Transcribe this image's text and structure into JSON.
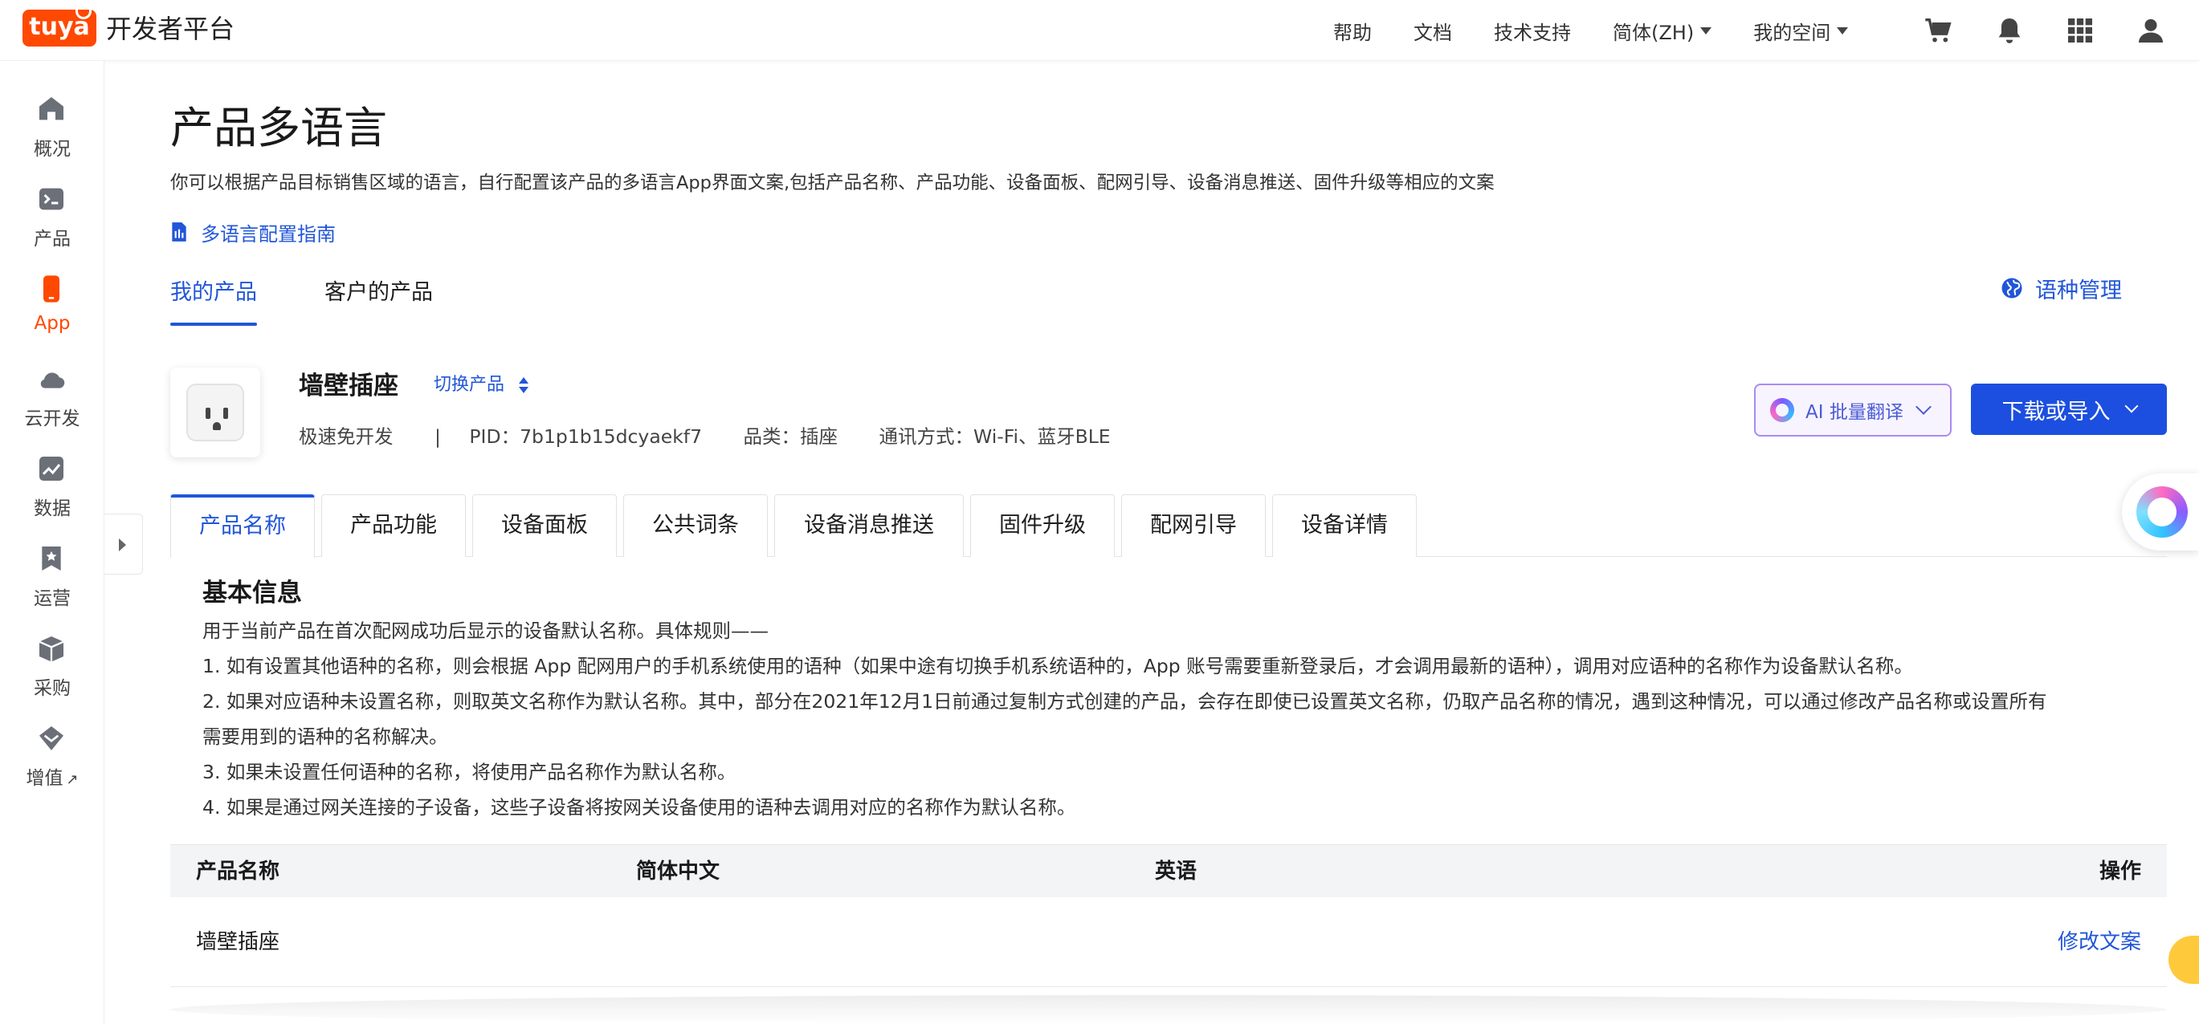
{
  "header": {
    "logo_text": "tuya",
    "brand": "开发者平台",
    "nav": [
      {
        "label": "帮助",
        "has_caret": false
      },
      {
        "label": "文档",
        "has_caret": false
      },
      {
        "label": "技术支持",
        "has_caret": false
      },
      {
        "label": "简体(ZH)",
        "has_caret": true
      },
      {
        "label": "我的空间",
        "has_caret": true
      }
    ],
    "icons": [
      "cart-icon",
      "bell-icon",
      "grid-apps-icon",
      "user-icon"
    ]
  },
  "sidebar": {
    "items": [
      {
        "label": "概况",
        "icon": "home-icon",
        "active": false
      },
      {
        "label": "产品",
        "icon": "terminal-icon",
        "active": false
      },
      {
        "label": "App",
        "icon": "phone-icon",
        "active": true
      },
      {
        "label": "云开发",
        "icon": "cloud-icon",
        "active": false
      },
      {
        "label": "数据",
        "icon": "chart-icon",
        "active": false
      },
      {
        "label": "运营",
        "icon": "bookmark-star-icon",
        "active": false
      },
      {
        "label": "采购",
        "icon": "box-icon",
        "active": false
      },
      {
        "label": "增值",
        "icon": "diamond-icon",
        "active": false,
        "external": true
      }
    ],
    "accent_color": "#ff4800"
  },
  "page": {
    "title": "产品多语言",
    "description": "你可以根据产品目标销售区域的语言，自行配置该产品的多语言App界面文案,包括产品名称、产品功能、设备面板、配网引导、设备消息推送、固件升级等相应的文案",
    "guide_link": "多语言配置指南",
    "tabs": [
      {
        "label": "我的产品",
        "active": true
      },
      {
        "label": "客户的产品",
        "active": false
      }
    ],
    "language_management": "语种管理"
  },
  "product": {
    "name": "墙壁插座",
    "switch_label": "切换产品",
    "dev_mode": "极速免开发",
    "separator": "|",
    "pid": "PID：7b1p1b15dcyaekf7",
    "category": "品类：插座",
    "comm": "通讯方式：Wi-Fi、蓝牙BLE"
  },
  "actions": {
    "ai_translate": "AI 批量翻译",
    "download_import": "下载或导入"
  },
  "sub_tabs": [
    {
      "label": "产品名称",
      "active": true
    },
    {
      "label": "产品功能",
      "active": false
    },
    {
      "label": "设备面板",
      "active": false
    },
    {
      "label": "公共词条",
      "active": false
    },
    {
      "label": "设备消息推送",
      "active": false
    },
    {
      "label": "固件升级",
      "active": false
    },
    {
      "label": "配网引导",
      "active": false
    },
    {
      "label": "设备详情",
      "active": false
    }
  ],
  "basic_info": {
    "title": "基本信息",
    "lines": [
      "用于当前产品在首次配网成功后显示的设备默认名称。具体规则——",
      "1. 如有设置其他语种的名称，则会根据 App 配网用户的手机系统使用的语种（如果中途有切换手机系统语种的，App 账号需要重新登录后，才会调用最新的语种），调用对应语种的名称作为设备默认名称。",
      "2. 如果对应语种未设置名称，则取英文名称作为默认名称。其中，部分在2021年12月1日前通过复制方式创建的产品，会存在即使已设置英文名称，仍取产品名称的情况，遇到这种情况，可以通过修改产品名称或设置所有",
      "需要用到的语种的名称解决。",
      "3. 如果未设置任何语种的名称，将使用产品名称作为默认名称。",
      "4. 如果是通过网关连接的子设备，这些子设备将按网关设备使用的语种去调用对应的名称作为默认名称。"
    ]
  },
  "table": {
    "headers": [
      "产品名称",
      "简体中文",
      "英语",
      "操作"
    ],
    "rows": [
      {
        "name": "墙壁插座",
        "zh": "",
        "en": "",
        "action": "修改文案"
      }
    ]
  },
  "colors": {
    "link_blue": "#2156d8",
    "primary_button": "#1c4fe0",
    "brand_orange": "#ff4800"
  }
}
